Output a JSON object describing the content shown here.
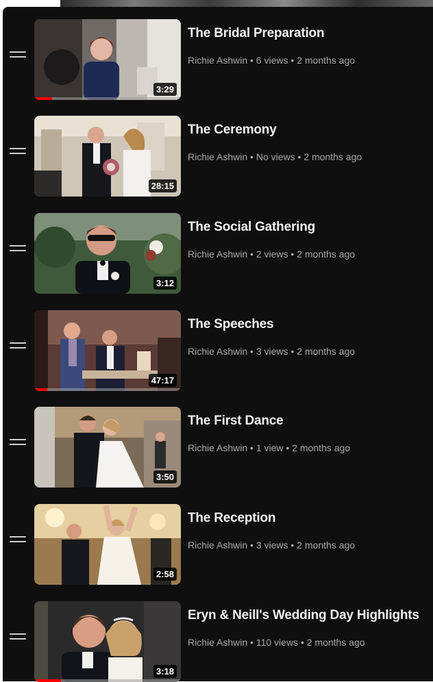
{
  "playlist": {
    "items": [
      {
        "title": "The Bridal Preparation",
        "channel": "Richie Ashwin",
        "views": "6 views",
        "age": "2 months ago",
        "duration": "3:29",
        "progress": 0.12
      },
      {
        "title": "The Ceremony",
        "channel": "Richie Ashwin",
        "views": "No views",
        "age": "2 months ago",
        "duration": "28:15",
        "progress": 0
      },
      {
        "title": "The Social Gathering",
        "channel": "Richie Ashwin",
        "views": "2 views",
        "age": "2 months ago",
        "duration": "3:12",
        "progress": 0
      },
      {
        "title": "The Speeches",
        "channel": "Richie Ashwin",
        "views": "3 views",
        "age": "2 months ago",
        "duration": "47:17",
        "progress": 0.09
      },
      {
        "title": "The First Dance",
        "channel": "Richie Ashwin",
        "views": "1 view",
        "age": "2 months ago",
        "duration": "3:50",
        "progress": 0
      },
      {
        "title": "The Reception",
        "channel": "Richie Ashwin",
        "views": "3 views",
        "age": "2 months ago",
        "duration": "2:58",
        "progress": 0
      },
      {
        "title": "Eryn & Neill's Wedding Day Highlights",
        "channel": "Richie Ashwin",
        "views": "110 views",
        "age": "2 months ago",
        "duration": "3:18",
        "progress": 0.18
      }
    ]
  },
  "colors": {
    "background": "#0f0f0f",
    "title": "#f1f1f1",
    "meta": "#aaaaaa",
    "progress": "#ff0000"
  },
  "icons": {
    "drag_handle": "drag-handle-icon"
  }
}
